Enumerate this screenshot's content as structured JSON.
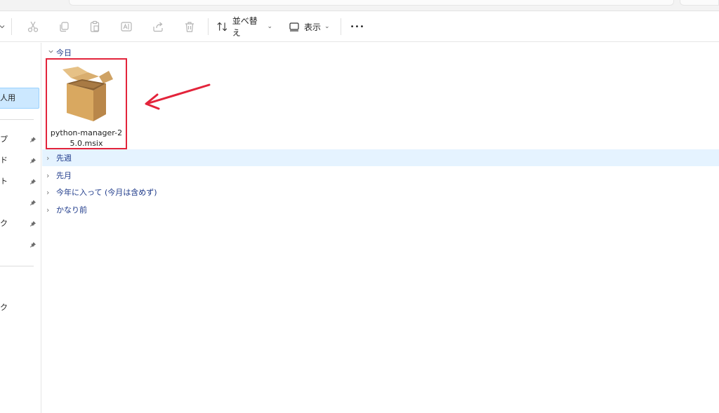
{
  "toolbar": {
    "sort_label": "並べ替え",
    "view_label": "表示",
    "more_label": "•••",
    "chevron": "⌄"
  },
  "sidebar": {
    "selected_label": "人用",
    "items": [
      {
        "label": "プ",
        "pinned": true
      },
      {
        "label": "ド",
        "pinned": true
      },
      {
        "label": "ト",
        "pinned": true
      },
      {
        "label": "",
        "pinned": true
      },
      {
        "label": "ク",
        "pinned": true
      },
      {
        "label": "",
        "pinned": true
      }
    ],
    "lower_item": "ク",
    "pin_glyph": "📌"
  },
  "content": {
    "today_group": "今日",
    "file": {
      "name": "python-manager-25.0.msix"
    },
    "groups": [
      {
        "label": "先週",
        "hover": true
      },
      {
        "label": "先月",
        "hover": false
      },
      {
        "label": "今年に入って (今月は含めず)",
        "hover": false
      },
      {
        "label": "かなり前",
        "hover": false
      }
    ],
    "chevron_right": "›",
    "chevron_down": "⌄"
  },
  "colors": {
    "highlight_border": "#e3243b",
    "selected_bg": "#cce8ff",
    "hover_bg": "#e5f3ff",
    "group_text": "#1e3a8a"
  }
}
